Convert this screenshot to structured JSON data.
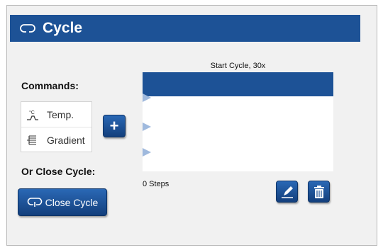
{
  "window": {
    "title": "Cycle",
    "title_icon": "cycle-loop-icon"
  },
  "commands": {
    "label": "Commands:",
    "items": [
      {
        "label": "Temp.",
        "icon": "temperature-icon"
      },
      {
        "label": "Gradient",
        "icon": "gradient-icon"
      }
    ],
    "add_button_glyph": "+"
  },
  "close_section": {
    "label": "Or Close Cycle:",
    "button_label": "Close Cycle",
    "button_icon": "cycle-loop-icon"
  },
  "cycle": {
    "header": "Start Cycle, 30x",
    "steps_label": "0 Steps",
    "edit_icon": "pencil-icon",
    "delete_icon": "trash-icon"
  },
  "colors": {
    "accent": "#1d5296",
    "panel_bg": "#f1f1f1",
    "marker": "#9fb9dd"
  }
}
